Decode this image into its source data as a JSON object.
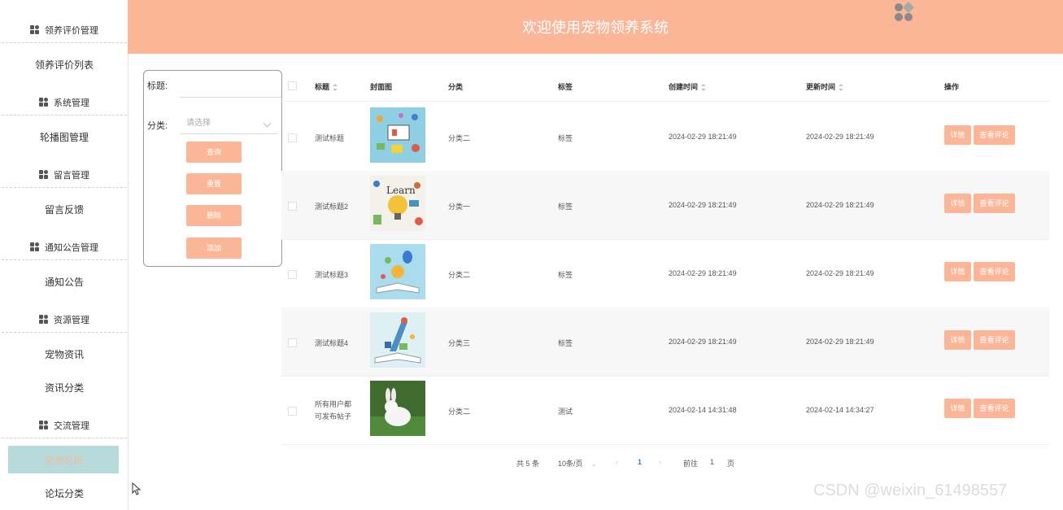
{
  "header": {
    "title": "欢迎使用宠物领养系统"
  },
  "sidebar": {
    "groups": [
      {
        "label": "领养评价管理",
        "items": [
          "领养评价列表"
        ]
      },
      {
        "label": "系统管理",
        "items": [
          "轮播图管理"
        ]
      },
      {
        "label": "留言管理",
        "items": [
          "留言反馈"
        ]
      },
      {
        "label": "通知公告管理",
        "items": [
          "通知公告"
        ]
      },
      {
        "label": "资源管理",
        "items": [
          "宠物资讯",
          "资讯分类"
        ]
      },
      {
        "label": "交流管理",
        "items": [
          "交流论坛",
          "论坛分类"
        ]
      }
    ],
    "active_item": "交流论坛"
  },
  "search": {
    "title_label": "标题:",
    "category_label": "分类:",
    "category_placeholder": "请选择",
    "buttons": {
      "query": "查询",
      "reset": "重置",
      "delete": "删除",
      "add": "添加"
    }
  },
  "table": {
    "columns": [
      "标题",
      "封面图",
      "分类",
      "标签",
      "创建时间",
      "更新时间",
      "操作"
    ],
    "rows": [
      {
        "title": "测试标题",
        "category": "分类二",
        "tag": "标签",
        "created": "2024-02-29 18:21:49",
        "updated": "2024-02-29 18:21:49"
      },
      {
        "title": "测试标题2",
        "category": "分类一",
        "tag": "标签",
        "created": "2024-02-29 18:21:49",
        "updated": "2024-02-29 18:21:49"
      },
      {
        "title": "测试标题3",
        "category": "分类二",
        "tag": "标签",
        "created": "2024-02-29 18:21:49",
        "updated": "2024-02-29 18:21:49"
      },
      {
        "title": "测试标题4",
        "category": "分类三",
        "tag": "标签",
        "created": "2024-02-29 18:21:49",
        "updated": "2024-02-29 18:21:49"
      },
      {
        "title": "所有用户都可发布帖子",
        "category": "分类二",
        "tag": "测试",
        "created": "2024-02-14 14:31:48",
        "updated": "2024-02-14 14:34:27"
      }
    ],
    "actions": {
      "detail": "详情",
      "comments": "查看评论"
    }
  },
  "pagination": {
    "total": "共 5 条",
    "page_size": "10条/页",
    "current_page": "1",
    "goto_prefix": "前往",
    "goto_value": "1",
    "goto_suffix": "页"
  },
  "watermark": "CSDN @weixin_61498557",
  "colors": {
    "accent": "#fbb698",
    "active_bg": "#b7dadb"
  }
}
